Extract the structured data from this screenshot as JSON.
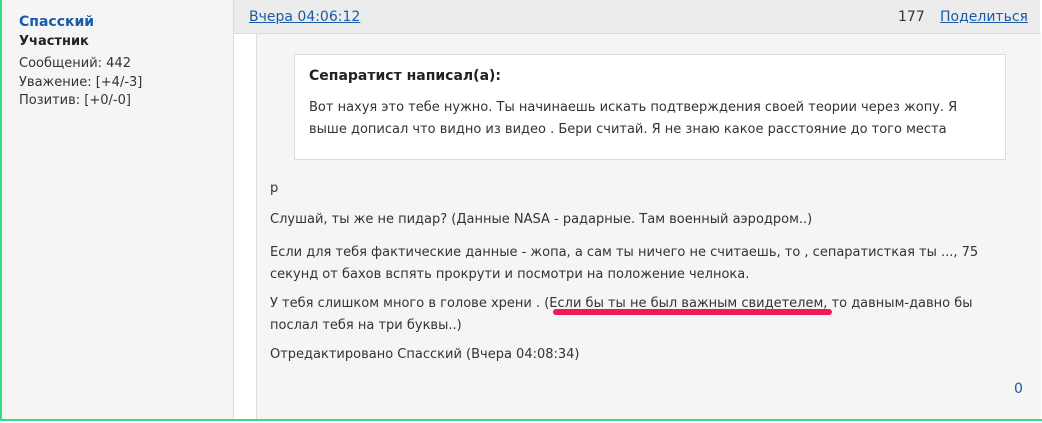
{
  "author": {
    "name": "Спасский",
    "role": "Участник",
    "stats": [
      "Сообщений: 442",
      "Уважение: [+4/-3]",
      "Позитив: [+0/-0]"
    ]
  },
  "post": {
    "date": "Вчера 04:06:12",
    "number": "177",
    "share_label": "Поделиться",
    "quote": {
      "title": "Сепаратист написал(а):",
      "text": "Вот нахуя это тебе нужно. Ты начинаешь искать подтверждения своей теории через жопу. Я выше дописал что видно из видео . Бери считай. Я не знаю какое расстояние до того места"
    },
    "paragraphs": [
      "р",
      "Слушай, ты же не пидар? (Данные NASA - радарные. Там военный аэродром..)",
      "Если для тебя фактические данные - жопа, а сам ты ничего не считаешь, то ,  сепаратисткая ты ..., 75 секунд от бахов вспять прокрути и посмотри на положение челнока.",
      "У тебя слишком много в голове хрени . (Если бы ты не был  важным свидетелем, то давным-давно бы послал тебя на три буквы..)",
      "Отредактировано Спасский (Вчера 04:08:34)"
    ],
    "likes": "0"
  },
  "colors": {
    "link": "#1a5aa6",
    "highlight_underline": "#ee1a5a",
    "frame": "#33dd88"
  }
}
